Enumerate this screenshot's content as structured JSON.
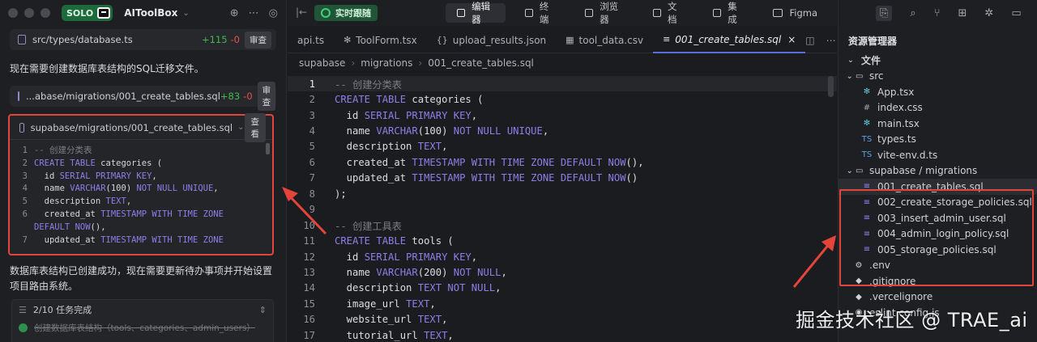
{
  "left": {
    "app_name": "AIToolBox",
    "solo_label": "SOLO",
    "chip1": {
      "path": "src/types/database.ts",
      "plus": "+115",
      "minus": "-0",
      "action": "审查"
    },
    "msg1": "现在需要创建数据库表结构的SQL迁移文件。",
    "chip2": {
      "path": "...abase/migrations/001_create_tables.sql",
      "plus": "+83",
      "minus": "-0",
      "action": "审查"
    },
    "card": {
      "path": "supabase/migrations/001_create_tables.sql",
      "view": "查看",
      "lines": [
        {
          "n": "1",
          "t": "-- 创建分类表"
        },
        {
          "n": "2",
          "t": "CREATE TABLE categories ("
        },
        {
          "n": "3",
          "t": "  id SERIAL PRIMARY KEY,"
        },
        {
          "n": "4",
          "t": "  name VARCHAR(100) NOT NULL UNIQUE,"
        },
        {
          "n": "5",
          "t": "  description TEXT,"
        },
        {
          "n": "6",
          "t": "  created_at TIMESTAMP WITH TIME ZONE"
        },
        {
          "n": "",
          "t": "DEFAULT NOW(),"
        },
        {
          "n": "7",
          "t": "  updated_at TIMESTAMP WITH TIME ZONE"
        }
      ]
    },
    "msg2": "数据库表结构已创建成功，现在需要更新待办事项并开始设置项目路由系统。",
    "tasks": {
      "header": "2/10 任务完成",
      "item": "创建数据库表结构（tools、categories、admin_users）"
    }
  },
  "center": {
    "live_label": "实时跟随",
    "modes": [
      "编辑器",
      "终端",
      "浏览器",
      "文档",
      "集成",
      "Figma"
    ],
    "tabs": [
      {
        "label": "api.ts",
        "icon": ""
      },
      {
        "label": "ToolForm.tsx",
        "icon": "✻"
      },
      {
        "label": "upload_results.json",
        "icon": "{}"
      },
      {
        "label": "tool_data.csv",
        "icon": "▦"
      },
      {
        "label": "001_create_tables.sql",
        "icon": "≡"
      }
    ],
    "breadcrumb": [
      "supabase",
      "migrations",
      "001_create_tables.sql"
    ],
    "code": [
      {
        "n": "1",
        "segs": [
          [
            "cm",
            "-- 创建分类表"
          ]
        ]
      },
      {
        "n": "2",
        "segs": [
          [
            "kw",
            "CREATE TABLE "
          ],
          [
            "id",
            "categories ("
          ]
        ]
      },
      {
        "n": "3",
        "segs": [
          [
            "id",
            "  id "
          ],
          [
            "kw",
            "SERIAL PRIMARY KEY"
          ],
          [
            "pl",
            ","
          ]
        ]
      },
      {
        "n": "4",
        "segs": [
          [
            "id",
            "  name "
          ],
          [
            "kw",
            "VARCHAR"
          ],
          [
            "pl",
            "(100) "
          ],
          [
            "kw",
            "NOT NULL UNIQUE"
          ],
          [
            "pl",
            ","
          ]
        ]
      },
      {
        "n": "5",
        "segs": [
          [
            "id",
            "  description "
          ],
          [
            "kw",
            "TEXT"
          ],
          [
            "pl",
            ","
          ]
        ]
      },
      {
        "n": "6",
        "segs": [
          [
            "id",
            "  created_at "
          ],
          [
            "kw",
            "TIMESTAMP WITH TIME ZONE DEFAULT NOW"
          ],
          [
            "pl",
            "(),"
          ]
        ]
      },
      {
        "n": "7",
        "segs": [
          [
            "id",
            "  updated_at "
          ],
          [
            "kw",
            "TIMESTAMP WITH TIME ZONE DEFAULT NOW"
          ],
          [
            "pl",
            "()"
          ]
        ]
      },
      {
        "n": "8",
        "segs": [
          [
            "pl",
            ");"
          ]
        ]
      },
      {
        "n": "9",
        "segs": []
      },
      {
        "n": "10",
        "segs": [
          [
            "cm",
            "-- 创建工具表"
          ]
        ]
      },
      {
        "n": "11",
        "segs": [
          [
            "kw",
            "CREATE TABLE "
          ],
          [
            "id",
            "tools ("
          ]
        ]
      },
      {
        "n": "12",
        "segs": [
          [
            "id",
            "  id "
          ],
          [
            "kw",
            "SERIAL PRIMARY KEY"
          ],
          [
            "pl",
            ","
          ]
        ]
      },
      {
        "n": "13",
        "segs": [
          [
            "id",
            "  name "
          ],
          [
            "kw",
            "VARCHAR"
          ],
          [
            "pl",
            "(200) "
          ],
          [
            "kw",
            "NOT NULL"
          ],
          [
            "pl",
            ","
          ]
        ]
      },
      {
        "n": "14",
        "segs": [
          [
            "id",
            "  description "
          ],
          [
            "kw",
            "TEXT NOT NULL"
          ],
          [
            "pl",
            ","
          ]
        ]
      },
      {
        "n": "15",
        "segs": [
          [
            "id",
            "  image_url "
          ],
          [
            "kw",
            "TEXT"
          ],
          [
            "pl",
            ","
          ]
        ]
      },
      {
        "n": "16",
        "segs": [
          [
            "id",
            "  website_url "
          ],
          [
            "kw",
            "TEXT"
          ],
          [
            "pl",
            ","
          ]
        ]
      },
      {
        "n": "17",
        "segs": [
          [
            "id",
            "  tutorial_url "
          ],
          [
            "kw",
            "TEXT"
          ],
          [
            "pl",
            ","
          ]
        ]
      }
    ]
  },
  "right": {
    "title": "资源管理器",
    "tree": [
      {
        "label": "文件",
        "icon": "⌄",
        "indent": 0,
        "bold": true
      },
      {
        "label": "src",
        "icon": "⌄ ▭",
        "indent": 0
      },
      {
        "label": "App.tsx",
        "icon": "✻",
        "indent": 2
      },
      {
        "label": "index.css",
        "icon": "#",
        "indent": 2
      },
      {
        "label": "main.tsx",
        "icon": "✻",
        "indent": 2
      },
      {
        "label": "types.ts",
        "icon": "TS",
        "indent": 2
      },
      {
        "label": "vite-env.d.ts",
        "icon": "TS",
        "indent": 2
      },
      {
        "label": "supabase / migrations",
        "icon": "⌄ ▭",
        "indent": 0
      },
      {
        "label": "001_create_tables.sql",
        "icon": "≡",
        "indent": 2,
        "sel": true
      },
      {
        "label": "002_create_storage_policies.sql",
        "icon": "≡",
        "indent": 2
      },
      {
        "label": "003_insert_admin_user.sql",
        "icon": "≡",
        "indent": 2
      },
      {
        "label": "004_admin_login_policy.sql",
        "icon": "≡",
        "indent": 2
      },
      {
        "label": "005_storage_policies.sql",
        "icon": "≡",
        "indent": 2
      },
      {
        "label": ".env",
        "icon": "⚙",
        "indent": 1
      },
      {
        "label": ".gitignore",
        "icon": "◆",
        "indent": 1
      },
      {
        "label": ".vercelignore",
        "icon": "◆",
        "indent": 1
      },
      {
        "label": "eslint.config.js",
        "icon": "◉",
        "indent": 1
      }
    ]
  },
  "watermark": "掘金技术社区 @ TRAE_ai",
  "colors": {
    "highlight_box": "#e5443b",
    "keyword": "#8f7ee8",
    "live": "#20553a"
  }
}
